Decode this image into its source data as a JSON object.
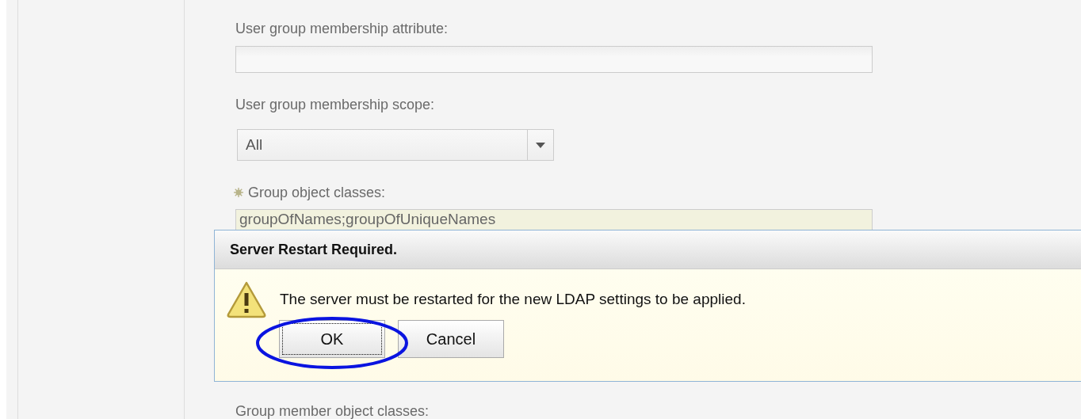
{
  "fields": [
    {
      "kind": "text",
      "label": "User group membership attribute:",
      "required": false
    },
    {
      "kind": "select",
      "label": "User group membership scope:",
      "value": "All",
      "required": false
    },
    {
      "kind": "textarea",
      "label": "Group object classes:",
      "value": "groupOfNames;groupOfUniqueNames",
      "required": true
    },
    {
      "kind": "label",
      "label": "Group member object classes:",
      "required": false
    }
  ],
  "dialog": {
    "title": "Server Restart Required.",
    "message": "The server must be restarted for the new LDAP settings to be applied.",
    "buttons": [
      {
        "label": "OK",
        "focused": true
      },
      {
        "label": "Cancel",
        "focused": false
      }
    ]
  }
}
